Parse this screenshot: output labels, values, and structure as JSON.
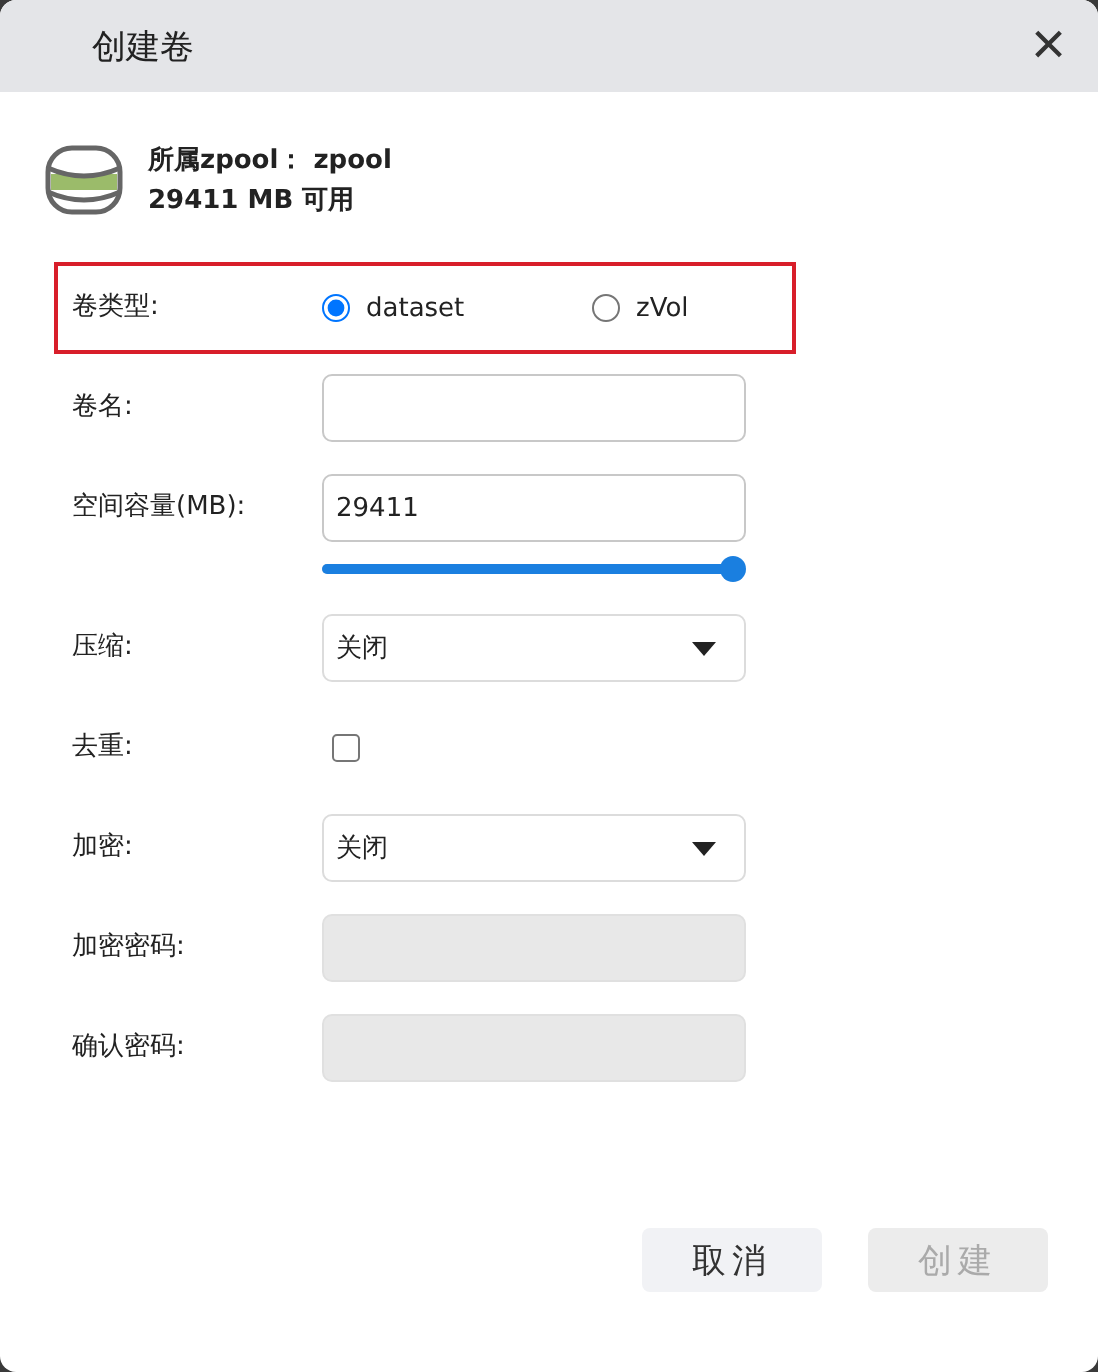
{
  "window": {
    "title": "创建卷",
    "close": "×"
  },
  "pool": {
    "name_line": "所属zpool： zpool",
    "free_line": "29411 MB 可用"
  },
  "fields": [
    {
      "kind": "radio",
      "label": "卷类型:",
      "highlighted": true,
      "options": [
        {
          "label": "dataset",
          "selected": true
        },
        {
          "label": "zVol",
          "selected": false
        }
      ]
    },
    {
      "kind": "input",
      "label": "卷名:"
    },
    {
      "kind": "slider",
      "label": "空间容量(MB):",
      "value": "29411",
      "level": 1
    },
    {
      "kind": "select",
      "label": "压缩:",
      "value": "关闭"
    },
    {
      "kind": "checkbox",
      "label": "去重:",
      "checked": false
    },
    {
      "kind": "select",
      "label": "加密:",
      "value": "关闭"
    },
    {
      "kind": "input",
      "label": "加密密码:",
      "disabled": true
    },
    {
      "kind": "input",
      "label": "确认密码:",
      "disabled": true
    }
  ],
  "buttons": [
    {
      "label": "取消",
      "disabled": false
    },
    {
      "label": "创建",
      "disabled": true
    }
  ]
}
